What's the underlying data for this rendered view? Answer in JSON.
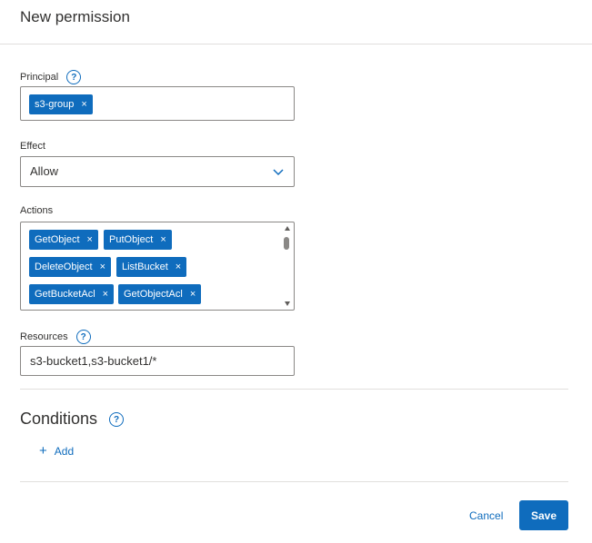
{
  "header": {
    "title": "New permission"
  },
  "principal": {
    "label": "Principal",
    "help": "?",
    "chips": [
      {
        "label": "s3-group",
        "remove": "×"
      }
    ]
  },
  "effect": {
    "label": "Effect",
    "value": "Allow"
  },
  "actions": {
    "label": "Actions",
    "chips": [
      {
        "label": "GetObject",
        "remove": "×"
      },
      {
        "label": "PutObject",
        "remove": "×"
      },
      {
        "label": "DeleteObject",
        "remove": "×"
      },
      {
        "label": "ListBucket",
        "remove": "×"
      },
      {
        "label": "GetBucketAcl",
        "remove": "×"
      },
      {
        "label": "GetObjectAcl",
        "remove": "×"
      }
    ]
  },
  "resources": {
    "label": "Resources",
    "help": "?",
    "value": "s3-bucket1,s3-bucket1/*"
  },
  "conditions": {
    "title": "Conditions",
    "help": "?",
    "add_plus": "+",
    "add_label": "Add"
  },
  "footer": {
    "cancel_label": "Cancel",
    "save_label": "Save"
  },
  "colors": {
    "accent": "#0f6cbd",
    "border": "#8a8886",
    "divider": "#e1dfdd"
  },
  "icons": {
    "principal_help": "question-circle-icon",
    "resources_help": "question-circle-icon",
    "conditions_help": "question-circle-icon",
    "effect_dropdown": "chevron-down-icon",
    "add": "plus-icon"
  }
}
